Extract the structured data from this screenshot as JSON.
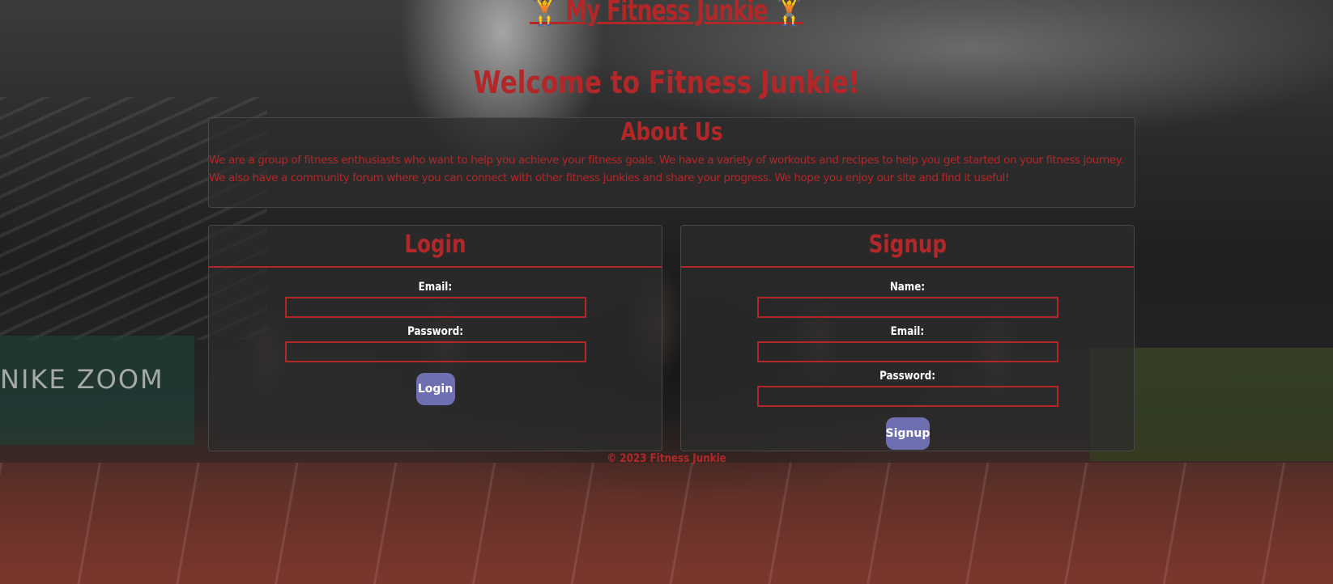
{
  "header": {
    "site_title": "🏋️ My Fitness Junkie 🏋️",
    "welcome": "Welcome to Fitness Junkie!"
  },
  "background": {
    "banner_text": "NIKE ZOOM"
  },
  "about": {
    "title": "About Us",
    "text": "We are a group of fitness enthusiasts who want to help you achieve your fitness goals. We have a variety of workouts and recipes to help you get started on your fitness journey. We also have a community forum where you can connect with other fitness junkies and share your progress. We hope you enjoy our site and find it useful!"
  },
  "login": {
    "title": "Login",
    "email_label": "Email:",
    "email_value": "",
    "password_label": "Password:",
    "password_value": "",
    "button_label": "Login"
  },
  "signup": {
    "title": "Signup",
    "name_label": "Name:",
    "name_value": "",
    "email_label": "Email:",
    "email_value": "",
    "password_label": "Password:",
    "password_value": "",
    "button_label": "Signup"
  },
  "footer": {
    "text": "© 2023 Fitness Junkie"
  },
  "colors": {
    "accent": "#b32728",
    "button": "#6e6fb0",
    "label": "#ffffff"
  }
}
